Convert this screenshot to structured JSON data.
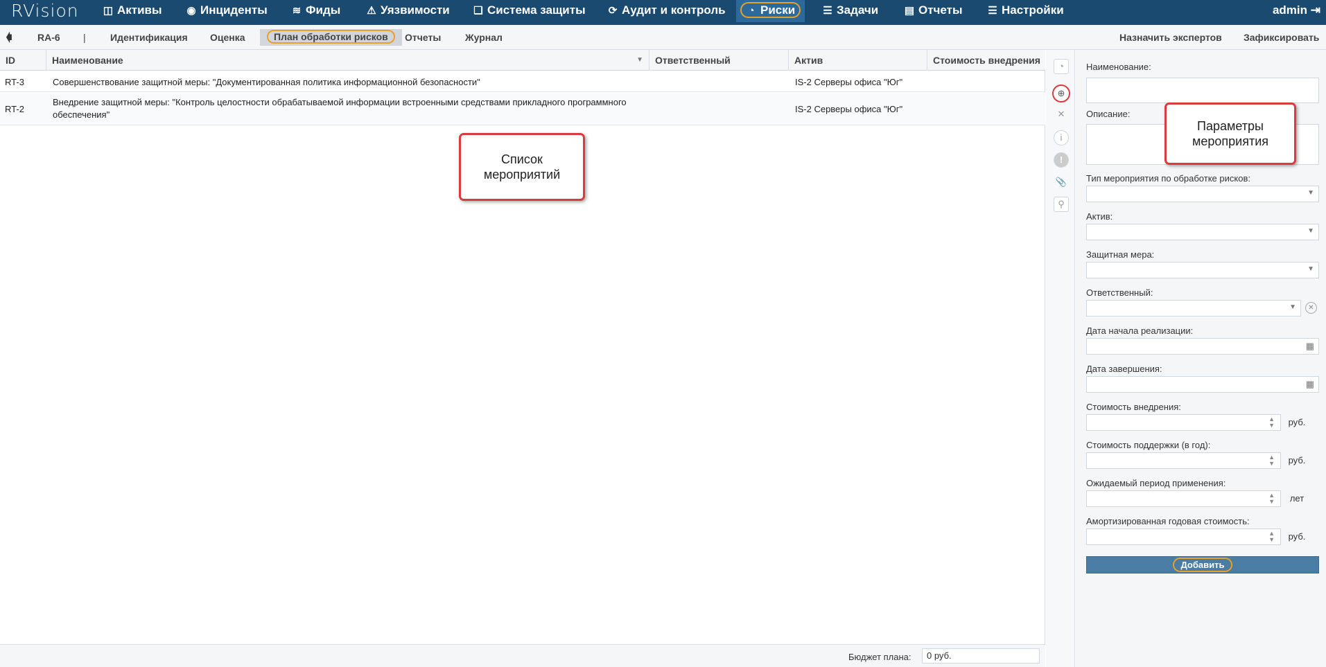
{
  "app": {
    "logo": "RVision",
    "user": "admin"
  },
  "nav": {
    "assets": "Активы",
    "incidents": "Инциденты",
    "feeds": "Фиды",
    "vulns": "Уязвимости",
    "protection": "Система защиты",
    "audit": "Аудит и контроль",
    "risks": "Риски",
    "tasks": "Задачи",
    "reports": "Отчеты",
    "settings": "Настройки"
  },
  "subnav": {
    "id": "RA-6",
    "sep": "|",
    "identification": "Идентификация",
    "assessment": "Оценка",
    "plan": "План обработки рисков",
    "reports": "Отчеты",
    "journal": "Журнал",
    "assign_experts": "Назначить экспертов",
    "fix": "Зафиксировать"
  },
  "table": {
    "columns": {
      "id": "ID",
      "name": "Наименование",
      "responsible": "Ответственный",
      "asset": "Актив",
      "cost": "Стоимость внедрения"
    },
    "rows": [
      {
        "id": "RT-3",
        "name": "Совершенствование защитной меры: \"Документированная политика информационной безопасности\"",
        "name2": "",
        "responsible": "",
        "asset": "IS-2 Серверы офиса \"Юг\"",
        "cost": ""
      },
      {
        "id": "RT-2",
        "name": "Внедрение защитной меры: \"Контроль целостности обрабатываемой информации встроенными средствами прикладного программного",
        "name2": "обеспечения\"",
        "responsible": "",
        "asset": "IS-2 Серверы офиса \"Юг\"",
        "cost": ""
      }
    ]
  },
  "footer": {
    "budget_label": "Бюджет плана:",
    "budget_value": "0 руб."
  },
  "form": {
    "name": "Наименование:",
    "description": "Описание:",
    "type": "Тип мероприятия по обработке рисков:",
    "asset": "Актив:",
    "measure": "Защитная мера:",
    "responsible": "Ответственный:",
    "start_date": "Дата начала реализации:",
    "end_date": "Дата завершения:",
    "impl_cost": "Стоимость внедрения:",
    "support_cost": "Стоимость поддержки (в год):",
    "period": "Ожидаемый период применения:",
    "amortized": "Амортизированная годовая стоимость:",
    "unit_rub": "руб.",
    "unit_years": "лет",
    "add_button": "Добавить"
  },
  "callouts": {
    "list_line1": "Список",
    "list_line2": "мероприятий",
    "params_line1": "Параметры",
    "params_line2": "мероприятия"
  },
  "colors": {
    "topbar": "#1a4a70",
    "highlight": "#e6a129",
    "callout_border": "#d93c3c",
    "button": "#4a7ca4"
  }
}
